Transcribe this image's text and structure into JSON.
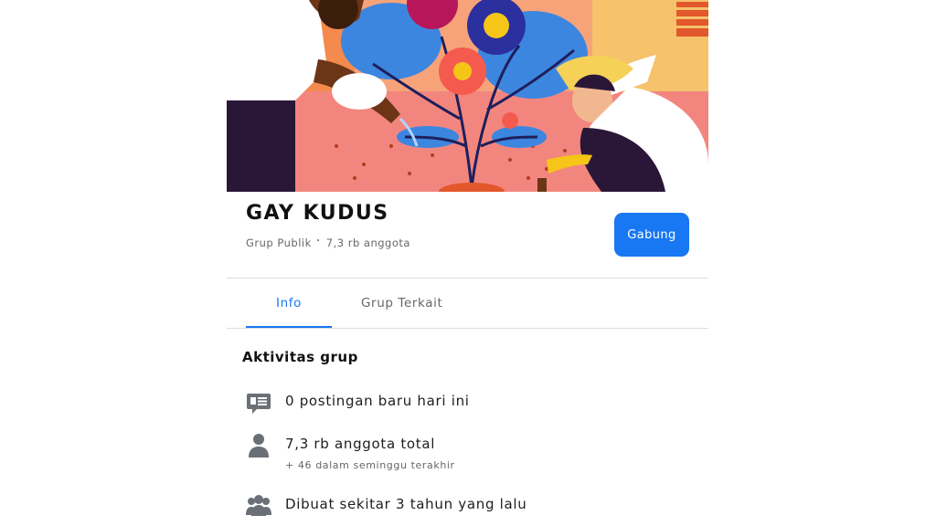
{
  "group": {
    "name": "GAY KUDUS",
    "privacy": "Grup Publik",
    "member_count": "7,3 rb anggota",
    "join_label": "Gabung"
  },
  "tabs": [
    {
      "label": "Info",
      "active": true
    },
    {
      "label": "Grup Terkait",
      "active": false
    }
  ],
  "activity": {
    "title": "Aktivitas grup",
    "items": [
      {
        "icon": "posts-icon",
        "text": "0 postingan baru hari ini"
      },
      {
        "icon": "person-icon",
        "text": "7,3 rb anggota total",
        "sub": "+ 46 dalam seminggu terakhir"
      },
      {
        "icon": "group-icon",
        "text": "Dibuat sekitar 3 tahun yang lalu"
      }
    ]
  },
  "colors": {
    "accent": "#1877f2",
    "muted": "#65676b",
    "divider": "#dadde1"
  }
}
